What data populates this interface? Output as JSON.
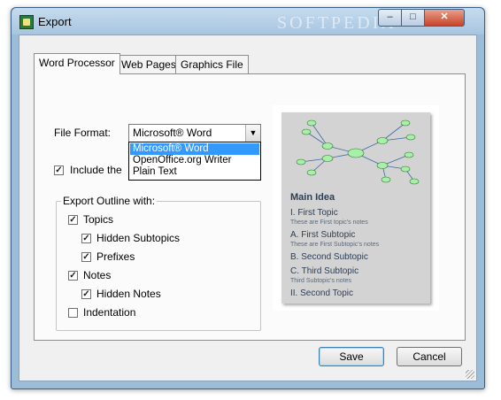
{
  "window": {
    "title": "Export",
    "watermark": "SOFTPEDIA",
    "controls": {
      "minimize": "–",
      "maximize": "□",
      "close": "✕"
    }
  },
  "tabs": [
    {
      "label": "Word Processor",
      "active": true
    },
    {
      "label": "Web Pages",
      "active": false
    },
    {
      "label": "Graphics File",
      "active": false
    }
  ],
  "file_format": {
    "label": "File Format:",
    "selected": "Microsoft® Word",
    "options": [
      "Microsoft® Word",
      "OpenOffice.org Writer",
      "Plain Text"
    ]
  },
  "include_checkbox": {
    "label": "Include the",
    "checked": true
  },
  "export_outline": {
    "legend": "Export Outline with:",
    "items": [
      {
        "label": "Topics",
        "checked": true
      },
      {
        "label": "Hidden Subtopics",
        "checked": true
      },
      {
        "label": "Prefixes",
        "checked": true
      },
      {
        "label": "Notes",
        "checked": true
      },
      {
        "label": "Hidden Notes",
        "checked": true
      },
      {
        "label": "Indentation",
        "checked": false
      }
    ]
  },
  "preview": {
    "main_idea": "Main Idea",
    "lines": [
      {
        "text": "I. First Topic",
        "note": "These are First topic's notes"
      },
      {
        "text": "A. First Subtopic",
        "note": "These are First Subtopic's notes"
      },
      {
        "text": "B. Second Subtopic",
        "note": ""
      },
      {
        "text": "C. Third Subtopic",
        "note": "Third Subtopic's notes"
      },
      {
        "text": "II. Second Topic",
        "note": ""
      }
    ]
  },
  "buttons": {
    "save": "Save",
    "cancel": "Cancel"
  },
  "colors": {
    "selection": "#3399ff",
    "node_fill": "#a8f0a8",
    "node_stroke": "#2a7a2a",
    "link": "#3a6aa8"
  }
}
